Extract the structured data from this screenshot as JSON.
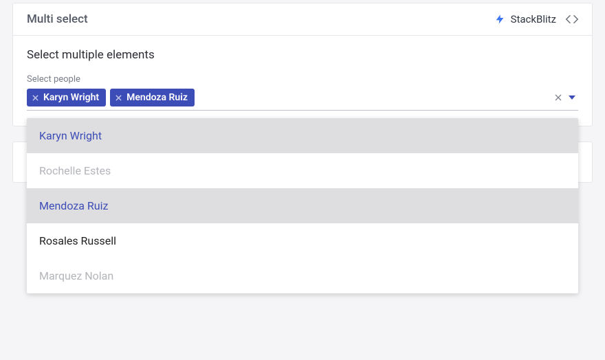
{
  "card": {
    "title": "Multi select",
    "stackblitz_label": "StackBlitz",
    "section_heading": "Select multiple elements",
    "field_label": "Select people"
  },
  "selected_chips": [
    {
      "label": "Karyn Wright"
    },
    {
      "label": "Mendoza Ruiz"
    }
  ],
  "options": [
    {
      "label": "Karyn Wright",
      "selected": true,
      "disabled": false
    },
    {
      "label": "Rochelle Estes",
      "selected": false,
      "disabled": true
    },
    {
      "label": "Mendoza Ruiz",
      "selected": true,
      "disabled": false
    },
    {
      "label": "Rosales Russell",
      "selected": false,
      "disabled": false
    },
    {
      "label": "Marquez Nolan",
      "selected": false,
      "disabled": true
    }
  ]
}
